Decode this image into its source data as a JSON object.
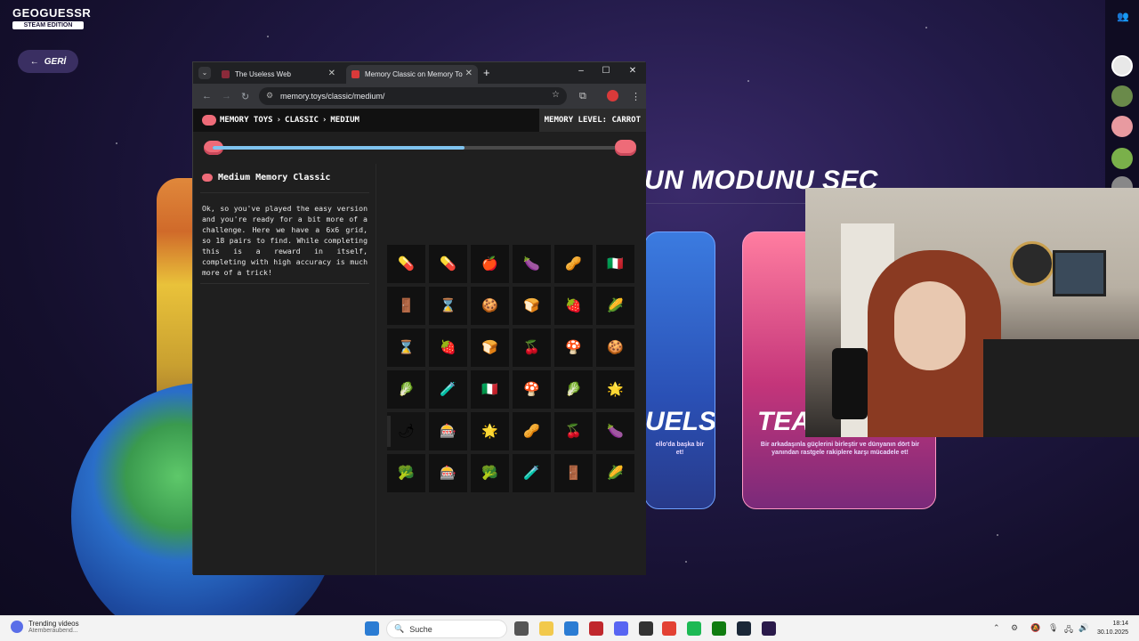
{
  "game": {
    "logo_line1": "GEOGUESSR",
    "logo_line2": "STEAM EDITION",
    "back_label": "GERİ",
    "mode_title": "UN MODUNU SEÇ",
    "duels_label": "UELS",
    "duels_desc": "ello'da başka bir\net!",
    "team_label": "TEA",
    "team_desc": "Bir arkadaşınla güçlerini birleştir ve dünyanın dört bir\nyanından rastgele rakiplere karşı mücadele et!"
  },
  "browser": {
    "tabs": [
      {
        "title": "The Useless Web",
        "favicon_color": "#8a2a3a"
      },
      {
        "title": "Memory Classic on Memory To",
        "favicon_color": "#d93a3a",
        "active": true
      }
    ],
    "url": "memory.toys/classic/medium/",
    "window_controls": {
      "minimize": "–",
      "maximize": "☐",
      "close": "✕"
    }
  },
  "page": {
    "breadcrumb": [
      "MEMORY TOYS",
      "CLASSIC",
      "MEDIUM"
    ],
    "breadcrumb_sep": "›",
    "memory_level": "MEMORY LEVEL: CARROT",
    "progress": 0.61,
    "panel_title": "Medium Memory Classic",
    "description": "Ok, so you've played the easy version and you're ready for a bit more of a challenge. Here we have a 6x6 grid, so 18 pairs to find. While completing this is a reward in itself, completing with high accuracy is much more of a trick!"
  },
  "grid": [
    [
      "💊",
      "💊",
      "🍎",
      "🍆",
      "🥜",
      "🇮🇹"
    ],
    [
      "🚪",
      "⌛",
      "🍪",
      "🍞",
      "🍓",
      "🌽"
    ],
    [
      "⌛",
      "🍓",
      "🍞",
      "🍒",
      "🍄",
      "🍪"
    ],
    [
      "🥬",
      "🧪",
      "🇮🇹",
      "🍄",
      "🥬",
      "🌟"
    ],
    [
      "🌶",
      "🎰",
      "🌟",
      "🥜",
      "🍒",
      "🍆"
    ],
    [
      "🥦",
      "🎰",
      "🥦",
      "🧪",
      "🚪",
      "🌽"
    ]
  ],
  "taskbar": {
    "weather_title": "Trending videos",
    "weather_sub": "Atemberaubend...",
    "search_label": "Suche",
    "time": "18:14",
    "date": "30.10.2025",
    "icons": [
      {
        "name": "windows-start-icon",
        "color": "#2b7cd3"
      },
      {
        "name": "task-view-icon",
        "color": "#555555"
      },
      {
        "name": "file-explorer-icon",
        "color": "#f2c94c"
      },
      {
        "name": "store-icon",
        "color": "#2b7cd3"
      },
      {
        "name": "netflix-app-icon",
        "color": "#c0282d"
      },
      {
        "name": "discord-icon",
        "color": "#5865f2"
      },
      {
        "name": "obs-icon",
        "color": "#333333"
      },
      {
        "name": "chrome-icon",
        "color": "#e34133"
      },
      {
        "name": "spotify-icon",
        "color": "#1db954"
      },
      {
        "name": "xbox-icon",
        "color": "#107c10"
      },
      {
        "name": "steam-icon",
        "color": "#1b2838"
      },
      {
        "name": "geoguessr-icon",
        "color": "#2a1a4a"
      }
    ]
  }
}
